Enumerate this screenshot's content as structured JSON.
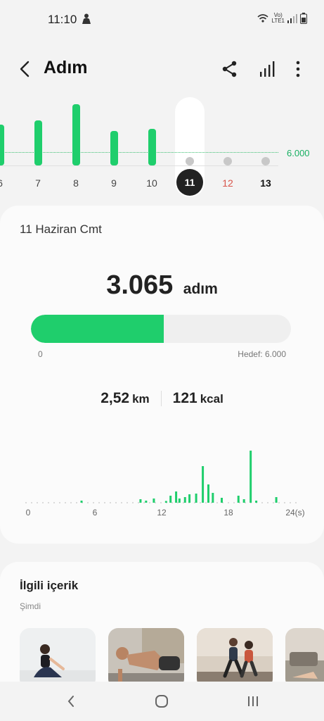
{
  "status_bar": {
    "time": "11:10",
    "network_line1": "Vo)",
    "network_line2": "LTE1"
  },
  "header": {
    "title": "Adım"
  },
  "week_chart": {
    "goal_label": "6.000",
    "days": [
      {
        "label": "6",
        "steps": 4500,
        "kind": "past"
      },
      {
        "label": "7",
        "steps": 4900,
        "kind": "past"
      },
      {
        "label": "8",
        "steps": 6700,
        "kind": "past"
      },
      {
        "label": "9",
        "steps": 3800,
        "kind": "past"
      },
      {
        "label": "10",
        "steps": 4000,
        "kind": "past"
      },
      {
        "label": "11",
        "steps": 3065,
        "kind": "selected"
      },
      {
        "label": "12",
        "steps": 0,
        "kind": "future-sunday"
      },
      {
        "label": "13",
        "steps": 0,
        "kind": "future-today"
      }
    ]
  },
  "detail": {
    "date": "11 Haziran Cmt",
    "steps": "3.065",
    "steps_unit": "adım",
    "progress_fraction": 0.511,
    "progress_min": "0",
    "progress_goal": "Hedef: 6.000",
    "distance_value": "2,52",
    "distance_unit": "km",
    "calories_value": "121",
    "calories_unit": "kcal"
  },
  "chart_data": {
    "type": "bar",
    "x_tick_labels": [
      "0",
      "6",
      "12",
      "18",
      "24(s)"
    ],
    "xlim": [
      0,
      24
    ],
    "x": [
      4.8,
      10.1,
      10.6,
      11.3,
      12.4,
      12.8,
      13.3,
      13.6,
      14.1,
      14.5,
      15.1,
      15.7,
      16.2,
      16.6,
      17.4,
      18.9,
      19.4,
      20.0,
      20.5,
      22.3
    ],
    "values": [
      6,
      10,
      6,
      12,
      5,
      20,
      32,
      12,
      16,
      24,
      26,
      104,
      52,
      28,
      14,
      20,
      10,
      148,
      6,
      16
    ],
    "grid": false
  },
  "related": {
    "title": "İlgili içerik",
    "subtitle": "Şimdi"
  },
  "colors": {
    "accent": "#1fce6c",
    "goal_text": "#19b063",
    "sunday": "#d8544a"
  }
}
